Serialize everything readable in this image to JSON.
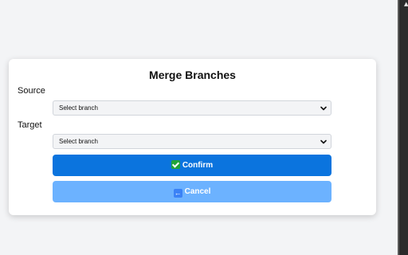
{
  "dialog": {
    "title": "Merge Branches",
    "source": {
      "label": "Source",
      "selected": "Select branch"
    },
    "target": {
      "label": "Target",
      "selected": "Select branch"
    },
    "confirm": {
      "label": "Confirm",
      "icon": "check-mark-button-icon"
    },
    "cancel": {
      "label": "Cancel",
      "icon": "back-arrow-icon"
    }
  },
  "colors": {
    "page_background": "#f3f4f6",
    "card_background": "#ffffff",
    "confirm_button": "#0b74de",
    "cancel_button": "#6cb2ff"
  }
}
